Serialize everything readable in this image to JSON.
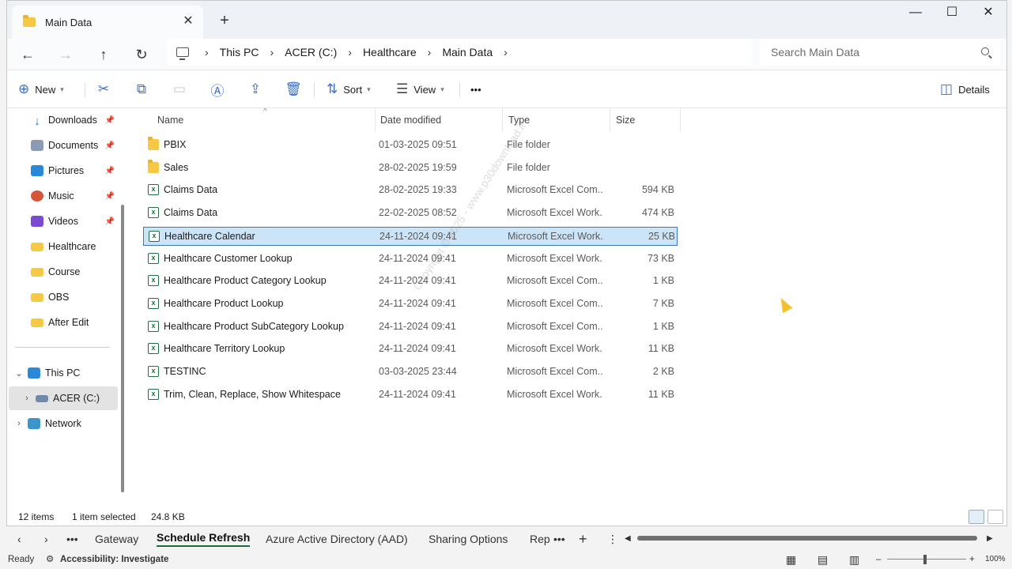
{
  "window": {
    "tab_title": "Main Data",
    "tab_close": "✕",
    "new_tab": "+",
    "minimize": "—",
    "maximize": "☐",
    "close": "✕"
  },
  "address": {
    "crumbs": [
      "This PC",
      "ACER (C:)",
      "Healthcare",
      "Main Data"
    ],
    "search_placeholder": "Search Main Data"
  },
  "commands": {
    "new": "New",
    "sort": "Sort",
    "view": "View",
    "more": "•••",
    "details": "Details"
  },
  "nav": {
    "quick": [
      {
        "label": "Downloads",
        "pinned": true
      },
      {
        "label": "Documents",
        "pinned": true
      },
      {
        "label": "Pictures",
        "pinned": true
      },
      {
        "label": "Music",
        "pinned": true
      },
      {
        "label": "Videos",
        "pinned": true
      },
      {
        "label": "Healthcare",
        "pinned": false
      },
      {
        "label": "Course",
        "pinned": false
      },
      {
        "label": "OBS",
        "pinned": false
      },
      {
        "label": "After Edit",
        "pinned": false
      }
    ],
    "this_pc": "This PC",
    "drive": "ACER (C:)",
    "network": "Network"
  },
  "columns": {
    "name": "Name",
    "date": "Date modified",
    "type": "Type",
    "size": "Size"
  },
  "files": [
    {
      "name": "PBIX",
      "date": "01-03-2025 09:51",
      "type": "File folder",
      "size": "",
      "kind": "folder"
    },
    {
      "name": "Sales",
      "date": "28-02-2025 19:59",
      "type": "File folder",
      "size": "",
      "kind": "folder"
    },
    {
      "name": "Claims Data",
      "date": "28-02-2025 19:33",
      "type": "Microsoft Excel Com...",
      "size": "594 KB",
      "kind": "excel"
    },
    {
      "name": "Claims Data",
      "date": "22-02-2025 08:52",
      "type": "Microsoft Excel Work...",
      "size": "474 KB",
      "kind": "excel"
    },
    {
      "name": "Healthcare Calendar",
      "date": "24-11-2024 09:41",
      "type": "Microsoft Excel Work...",
      "size": "25 KB",
      "kind": "excel",
      "selected": true
    },
    {
      "name": "Healthcare Customer Lookup",
      "date": "24-11-2024 09:41",
      "type": "Microsoft Excel Work...",
      "size": "73 KB",
      "kind": "excel"
    },
    {
      "name": "Healthcare Product Category Lookup",
      "date": "24-11-2024 09:41",
      "type": "Microsoft Excel Com...",
      "size": "1 KB",
      "kind": "excel"
    },
    {
      "name": "Healthcare Product Lookup",
      "date": "24-11-2024 09:41",
      "type": "Microsoft Excel Com...",
      "size": "7 KB",
      "kind": "excel"
    },
    {
      "name": "Healthcare Product SubCategory Lookup",
      "date": "24-11-2024 09:41",
      "type": "Microsoft Excel Com...",
      "size": "1 KB",
      "kind": "excel"
    },
    {
      "name": "Healthcare Territory Lookup",
      "date": "24-11-2024 09:41",
      "type": "Microsoft Excel Work...",
      "size": "11 KB",
      "kind": "excel"
    },
    {
      "name": "TESTINC",
      "date": "03-03-2025 23:44",
      "type": "Microsoft Excel Com...",
      "size": "2 KB",
      "kind": "excel"
    },
    {
      "name": "Trim, Clean, Replace, Show Whitespace",
      "date": "24-11-2024 09:41",
      "type": "Microsoft Excel Work...",
      "size": "11 KB",
      "kind": "excel"
    }
  ],
  "watermark": "Copyright © 2025 - www.p30download.ir",
  "status": {
    "items": "12 items",
    "selected": "1 item selected",
    "size": "24.8 KB"
  },
  "excel": {
    "sheets": [
      "Gateway",
      "Schedule Refresh",
      "Azure Active Directory (AAD)",
      "Sharing Options",
      "Rep"
    ],
    "active_sheet": "Schedule Refresh",
    "ready": "Ready",
    "accessibility": "Accessibility: Investigate",
    "zoom": "100%"
  }
}
